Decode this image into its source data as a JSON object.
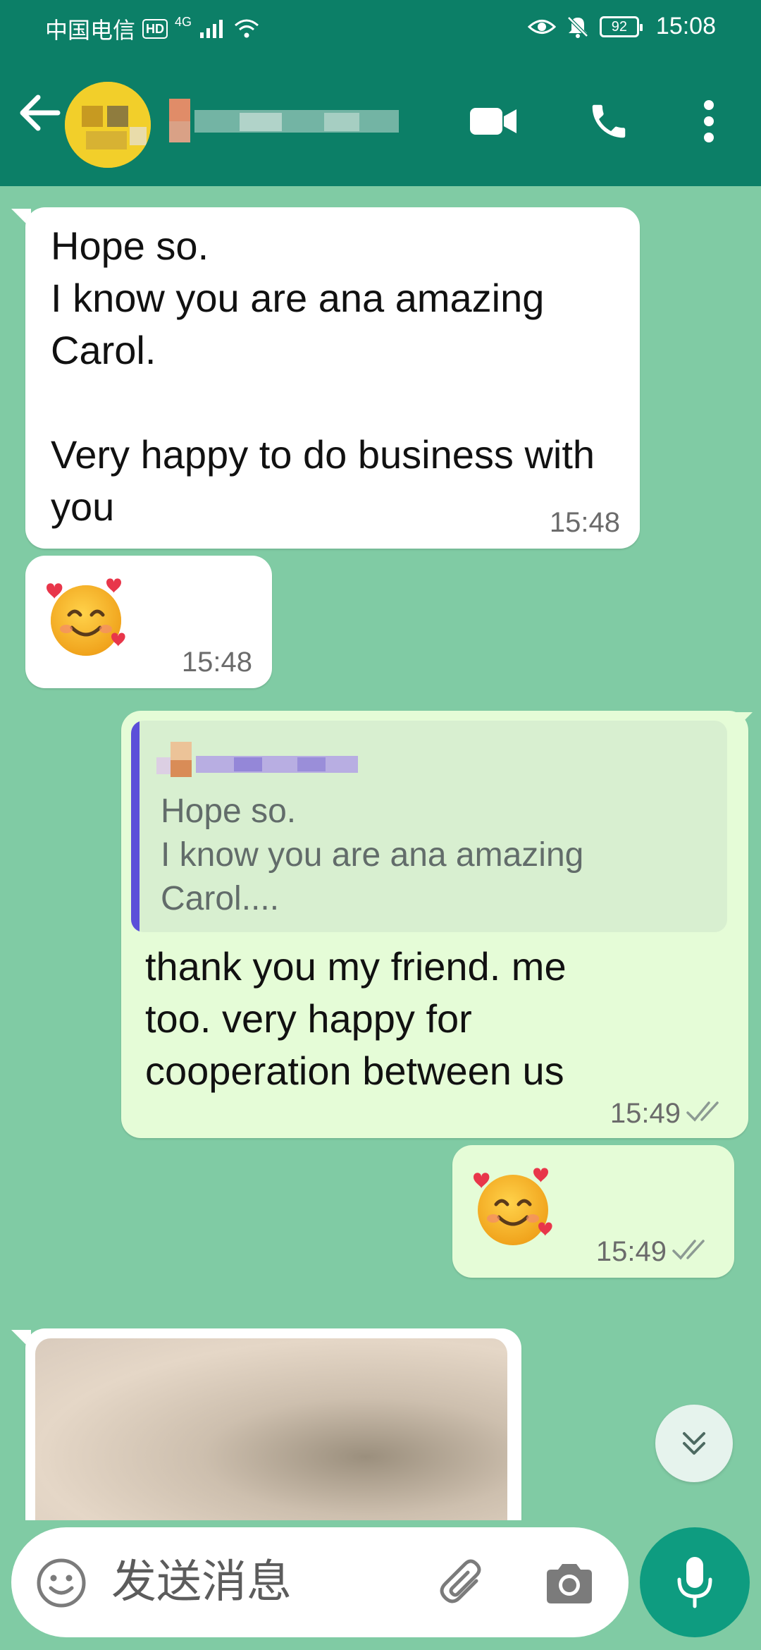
{
  "status_bar": {
    "carrier": "中国电信",
    "hd_badge": "HD",
    "network": "4G",
    "battery": "92",
    "time": "15:08"
  },
  "header": {
    "icons": [
      "back-arrow-icon",
      "video-call-icon",
      "voice-call-icon",
      "more-vert-icon"
    ]
  },
  "messages": [
    {
      "direction": "incoming",
      "text": "Hope so.\nI know you are ana amazing Carol.\n\nVery happy to do business with you",
      "time": "15:48"
    },
    {
      "direction": "incoming",
      "emoji": "🥰",
      "time": "15:48"
    },
    {
      "direction": "outgoing",
      "quote_text": "Hope so.\nI know you are ana amazing\nCarol....",
      "text": "thank you  my friend. me\ntoo. very happy for\ncooperation between us",
      "time": "15:49",
      "status": "read"
    },
    {
      "direction": "outgoing",
      "emoji": "🥰",
      "time": "15:49",
      "status": "read"
    },
    {
      "direction": "incoming",
      "type": "photo"
    }
  ],
  "input": {
    "placeholder": "发送消息"
  },
  "colors": {
    "header": "#0c7f67",
    "chat_background": "#80cba4",
    "outgoing_bubble": "#e5fcd7",
    "incoming_bubble": "#ffffff",
    "mic_button": "#0e9c80",
    "quote_bar": "#5b4fd9"
  }
}
